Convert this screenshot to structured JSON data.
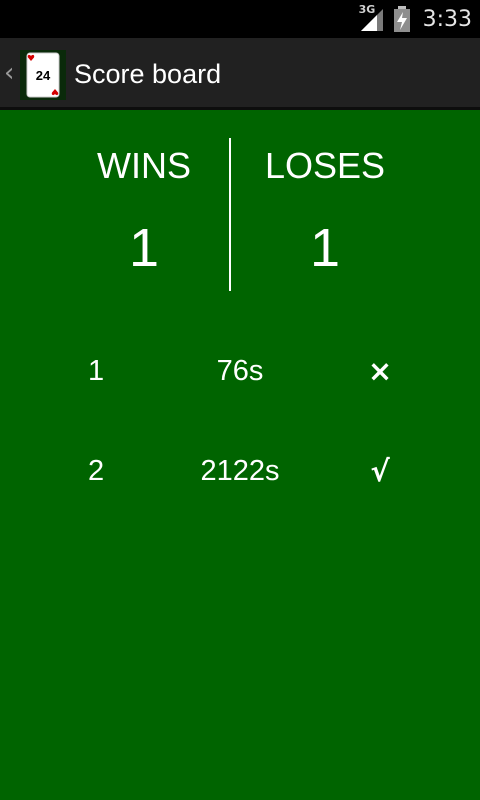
{
  "status_bar": {
    "network_label": "3G",
    "time": "3:33",
    "icons": [
      "signal-icon",
      "battery-charging-icon"
    ]
  },
  "action_bar": {
    "title": "Score board",
    "app_icon_card": "24"
  },
  "scoreboard": {
    "wins_label": "WINS",
    "wins_count": "1",
    "loses_label": "LOSES",
    "loses_count": "1"
  },
  "games": [
    {
      "index": "1",
      "time": "76s",
      "result_icon": "cross-icon",
      "result_symbol": "×"
    },
    {
      "index": "2",
      "time": "2122s",
      "result_icon": "check-icon",
      "result_symbol": "√"
    }
  ],
  "colors": {
    "background": "#006400",
    "action_bar": "#212121",
    "status_bar": "#000000",
    "text": "#ffffff"
  }
}
